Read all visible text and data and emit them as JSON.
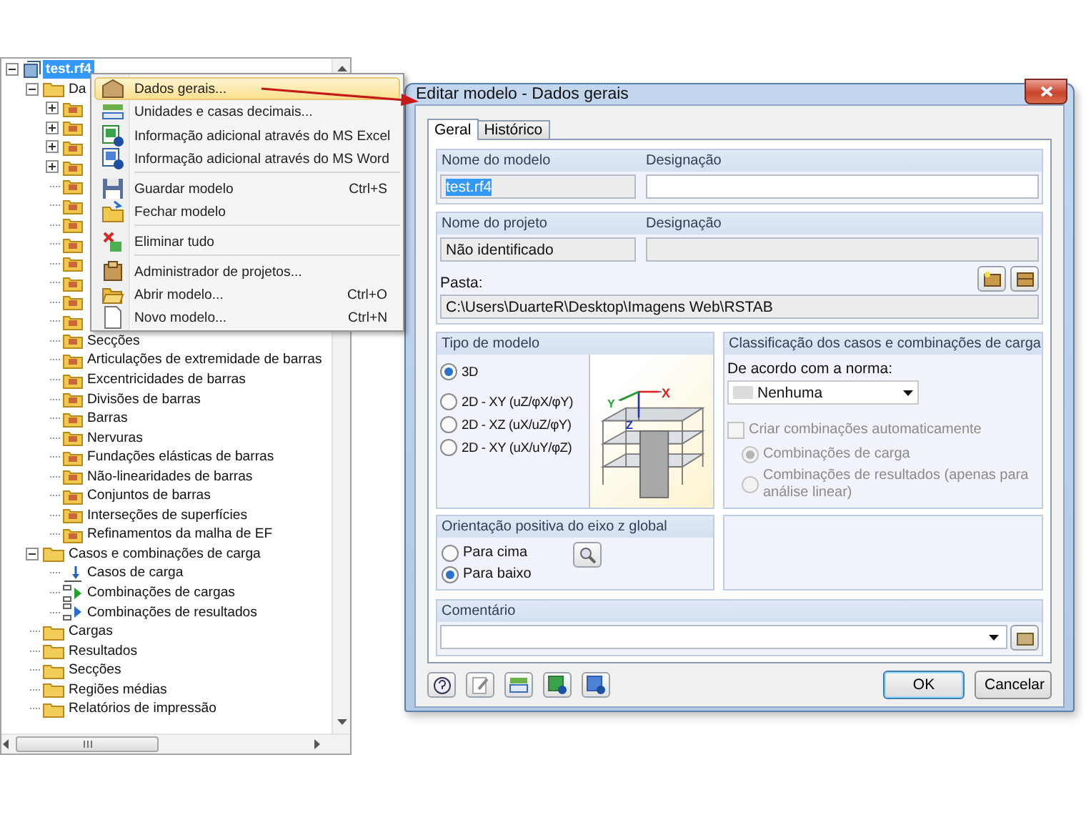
{
  "tree": {
    "items": [
      {
        "label": "test.rf4",
        "kind": "model",
        "selected": true,
        "expanded": true,
        "children": [
          {
            "label": "Da",
            "kind": "folder",
            "selected": false,
            "expanded": true,
            "children": [
              {
                "kind": "object",
                "expanded": false
              },
              {
                "kind": "object",
                "expanded": false
              },
              {
                "kind": "object",
                "expanded": false
              },
              {
                "kind": "object",
                "expanded": false
              },
              {
                "kind": "object"
              },
              {
                "kind": "object"
              },
              {
                "kind": "object"
              },
              {
                "kind": "object"
              },
              {
                "kind": "object"
              },
              {
                "kind": "object"
              },
              {
                "kind": "object"
              },
              {
                "kind": "object"
              },
              {
                "label": "Secções",
                "kind": "object",
                "selected": false
              },
              {
                "label": "Articulações de extremidade de barras",
                "kind": "object",
                "selected": false
              },
              {
                "label": "Excentricidades de barras",
                "kind": "object",
                "selected": false
              },
              {
                "label": "Divisões de barras",
                "kind": "object",
                "selected": false
              },
              {
                "label": "Barras",
                "kind": "object",
                "selected": false
              },
              {
                "label": "Nervuras",
                "kind": "object",
                "selected": false
              },
              {
                "label": "Fundações elásticas de barras",
                "kind": "object",
                "selected": false
              },
              {
                "label": "Não-linearidades de barras",
                "kind": "object",
                "selected": false
              },
              {
                "label": "Conjuntos de barras",
                "kind": "object",
                "selected": false
              },
              {
                "label": "Interseções de superfícies",
                "kind": "object",
                "selected": false
              },
              {
                "label": "Refinamentos da malha de EF",
                "kind": "object",
                "selected": false
              }
            ]
          },
          {
            "label": "Casos e combinações de carga",
            "kind": "folder",
            "selected": false,
            "expanded": true,
            "children": [
              {
                "label": "Casos de carga",
                "kind": "load-case",
                "selected": false
              },
              {
                "label": "Combinações de cargas",
                "kind": "combination",
                "selected": false
              },
              {
                "label": "Combinações de resultados",
                "kind": "result-combination",
                "selected": false
              }
            ]
          },
          {
            "label": "Cargas",
            "kind": "folder",
            "selected": false
          },
          {
            "label": "Resultados",
            "kind": "folder",
            "selected": false
          },
          {
            "label": "Secções",
            "kind": "folder",
            "selected": false
          },
          {
            "label": "Regiões médias",
            "kind": "folder",
            "selected": false
          },
          {
            "label": "Relatórios de impressão",
            "kind": "folder",
            "selected": false
          }
        ]
      }
    ]
  },
  "context_menu": {
    "items": [
      {
        "kind": "item",
        "label": "Dados gerais...",
        "highlighted": true
      },
      {
        "kind": "item",
        "label": "Unidades e casas decimais...",
        "highlighted": false
      },
      {
        "kind": "item",
        "label": "Informação adicional através do MS Excel",
        "highlighted": false
      },
      {
        "kind": "item",
        "label": "Informação adicional através do MS Word",
        "highlighted": false
      },
      {
        "kind": "separator"
      },
      {
        "kind": "item",
        "label": "Guardar modelo",
        "shortcut": "Ctrl+S",
        "highlighted": false
      },
      {
        "kind": "item",
        "label": "Fechar modelo",
        "highlighted": false
      },
      {
        "kind": "separator"
      },
      {
        "kind": "item",
        "label": "Eliminar tudo",
        "highlighted": false
      },
      {
        "kind": "separator"
      },
      {
        "kind": "item",
        "label": "Administrador de projetos...",
        "highlighted": false
      },
      {
        "kind": "item",
        "label": "Abrir modelo...",
        "shortcut": "Ctrl+O",
        "highlighted": false
      },
      {
        "kind": "item",
        "label": "Novo modelo...",
        "shortcut": "Ctrl+N",
        "highlighted": false
      }
    ]
  },
  "dialog": {
    "title": "Editar modelo - Dados gerais",
    "tabs": [
      {
        "label": "Geral",
        "selected": true
      },
      {
        "label": "Histórico",
        "selected": false
      }
    ],
    "model": {
      "name_label": "Nome do modelo",
      "name_value": "test.rf4",
      "name_text_selected": true,
      "designation_label": "Designação"
    },
    "project": {
      "name_label": "Nome do projeto",
      "name_value": "Não identificado",
      "designation_label": "Designação",
      "designation_disabled": true,
      "folder_label": "Pasta:",
      "folder_value": "C:\\Users\\DuarteR\\Desktop\\Imagens Web\\RSTAB"
    },
    "model_type": {
      "title": "Tipo de modelo",
      "axis_labels": [
        "X",
        "Y",
        "Z"
      ],
      "options": [
        {
          "label": "3D",
          "selected": true
        },
        {
          "label": "2D - XY (uZ/φX/φY)",
          "selected": false
        },
        {
          "label": "2D - XZ (uX/uZ/φY)",
          "selected": false
        },
        {
          "label": "2D - XY (uX/uY/φZ)",
          "selected": false
        }
      ]
    },
    "classification": {
      "title": "Classificação dos casos e combinações de carga",
      "norm_label": "De acordo com a norma:",
      "norm_value": "Nenhuma",
      "auto_combinations": {
        "label": "Criar combinações automaticamente",
        "checked": false,
        "disabled": true
      },
      "options": [
        {
          "label": "Combinações de carga",
          "selected": true,
          "disabled": true
        },
        {
          "label": "Combinações de resultados (apenas para análise linear)",
          "selected": false,
          "disabled": true
        }
      ]
    },
    "z_orientation": {
      "title": "Orientação positiva do eixo z global",
      "options": [
        {
          "label": "Para cima",
          "selected": false
        },
        {
          "label": "Para baixo",
          "selected": true
        }
      ]
    },
    "comment": {
      "label": "Comentário"
    },
    "buttons": [
      {
        "label": "OK",
        "default": true
      },
      {
        "label": "Cancelar",
        "default": false
      }
    ]
  }
}
